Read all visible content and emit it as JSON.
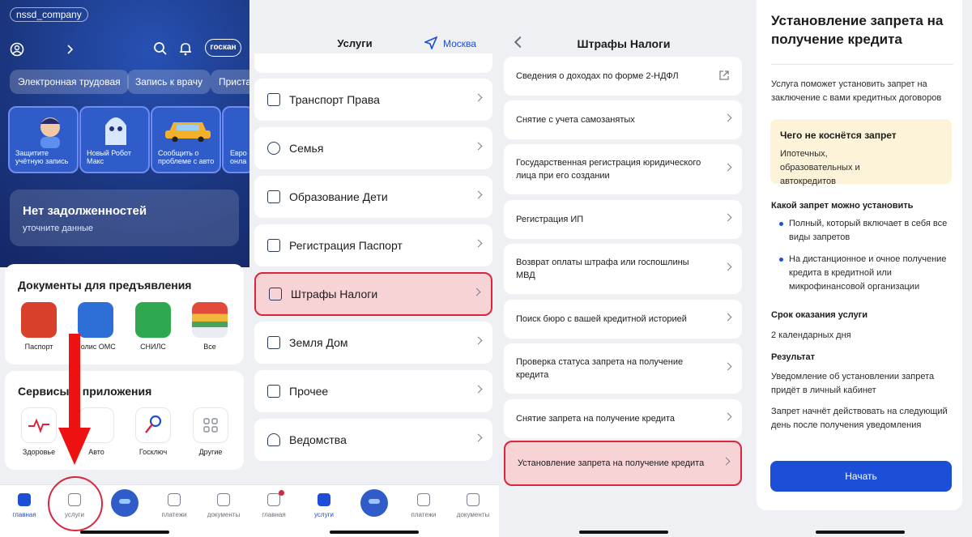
{
  "panel1": {
    "username": "nssd_company",
    "gos_label": "госкан",
    "chips": [
      "Электронная трудовая",
      "Запись к врачу",
      "Приста"
    ],
    "stories": [
      "Защитите учётную запись",
      "Новый Робот Макс",
      "Сообщить о проблеме с авто",
      "Евро онла"
    ],
    "debt_title": "Нет задолженностей",
    "debt_subtitle": "уточните данные",
    "docs_title": "Документы для предъявления",
    "docs": [
      "Паспорт",
      "Полис ОМС",
      "СНИЛС",
      "Все"
    ],
    "services_title": "Сервисы и приложения",
    "services": [
      "Здоровье",
      "Авто",
      "Госключ",
      "Другие"
    ],
    "tabs": [
      "главная",
      "услуги",
      "платежи",
      "документы"
    ],
    "accent_colors": {
      "brand": "#1d4ed8",
      "highlight": "#d7263d"
    }
  },
  "panel2": {
    "title": "Услуги",
    "city": "Москва",
    "rows": [
      "Транспорт Права",
      "Семья",
      "Образование Дети",
      "Регистрация Паспорт",
      "Штрафы Налоги",
      "Земля Дом",
      "Прочее",
      "Ведомства"
    ],
    "tabs": [
      "главная",
      "услуги",
      "платежи",
      "документы"
    ]
  },
  "panel3": {
    "title": "Штрафы Налоги",
    "rows": [
      "Сведения о доходах по форме 2-НДФЛ",
      "Снятие с учета самозанятых",
      "Государственная регистрация юридического лица при его создании",
      "Регистрация ИП",
      "Возврат оплаты штрафа или госпошлины МВД",
      "Поиск бюро с вашей кредитной историей",
      "Проверка статуса запрета на получение кредита",
      "Снятие запрета на получение кредита",
      "Установление запрета на получение кредита"
    ]
  },
  "panel4": {
    "title": "Установление запрета на получение кредита",
    "intro": "Услуга поможет установить запрет на заключение с вами кредитных договоров",
    "note_title": "Чего не коснётся запрет",
    "note_text": "Ипотечных, образовательных и автокредитов",
    "kinds_title": "Какой запрет можно установить",
    "kinds": [
      "Полный, который включает в себя все виды запретов",
      "На дистанционное и очное получение кредита в кредитной или микрофинансовой организации"
    ],
    "term_title": "Срок оказания услуги",
    "term_value": "2 календарных дня",
    "result_title": "Результат",
    "result_1": "Уведомление об установлении запрета придёт в личный кабинет",
    "result_2": "Запрет начнёт действовать на следующий день после получения уведомления",
    "start_button": "Начать"
  }
}
